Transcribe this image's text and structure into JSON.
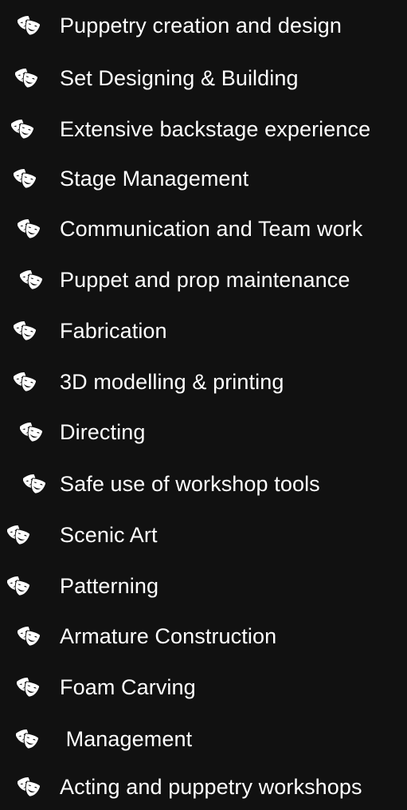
{
  "skills": {
    "icon": "theater-masks-icon",
    "text_color": "#ffffff",
    "background_color": "#111111",
    "items": [
      {
        "label": "Puppetry creation and design"
      },
      {
        "label": "Set Designing & Building"
      },
      {
        "label": "Extensive backstage experience"
      },
      {
        "label": "Stage Management"
      },
      {
        "label": "Communication and Team work"
      },
      {
        "label": "Puppet and prop maintenance"
      },
      {
        "label": "Fabrication"
      },
      {
        "label": "3D modelling & printing"
      },
      {
        "label": "Directing"
      },
      {
        "label": "Safe use of workshop tools"
      },
      {
        "label": "Scenic Art"
      },
      {
        "label": "Patterning"
      },
      {
        "label": "Armature Construction"
      },
      {
        "label": "Foam Carving"
      },
      {
        "label": " Management"
      },
      {
        "label": "Acting and puppetry workshops"
      }
    ]
  }
}
